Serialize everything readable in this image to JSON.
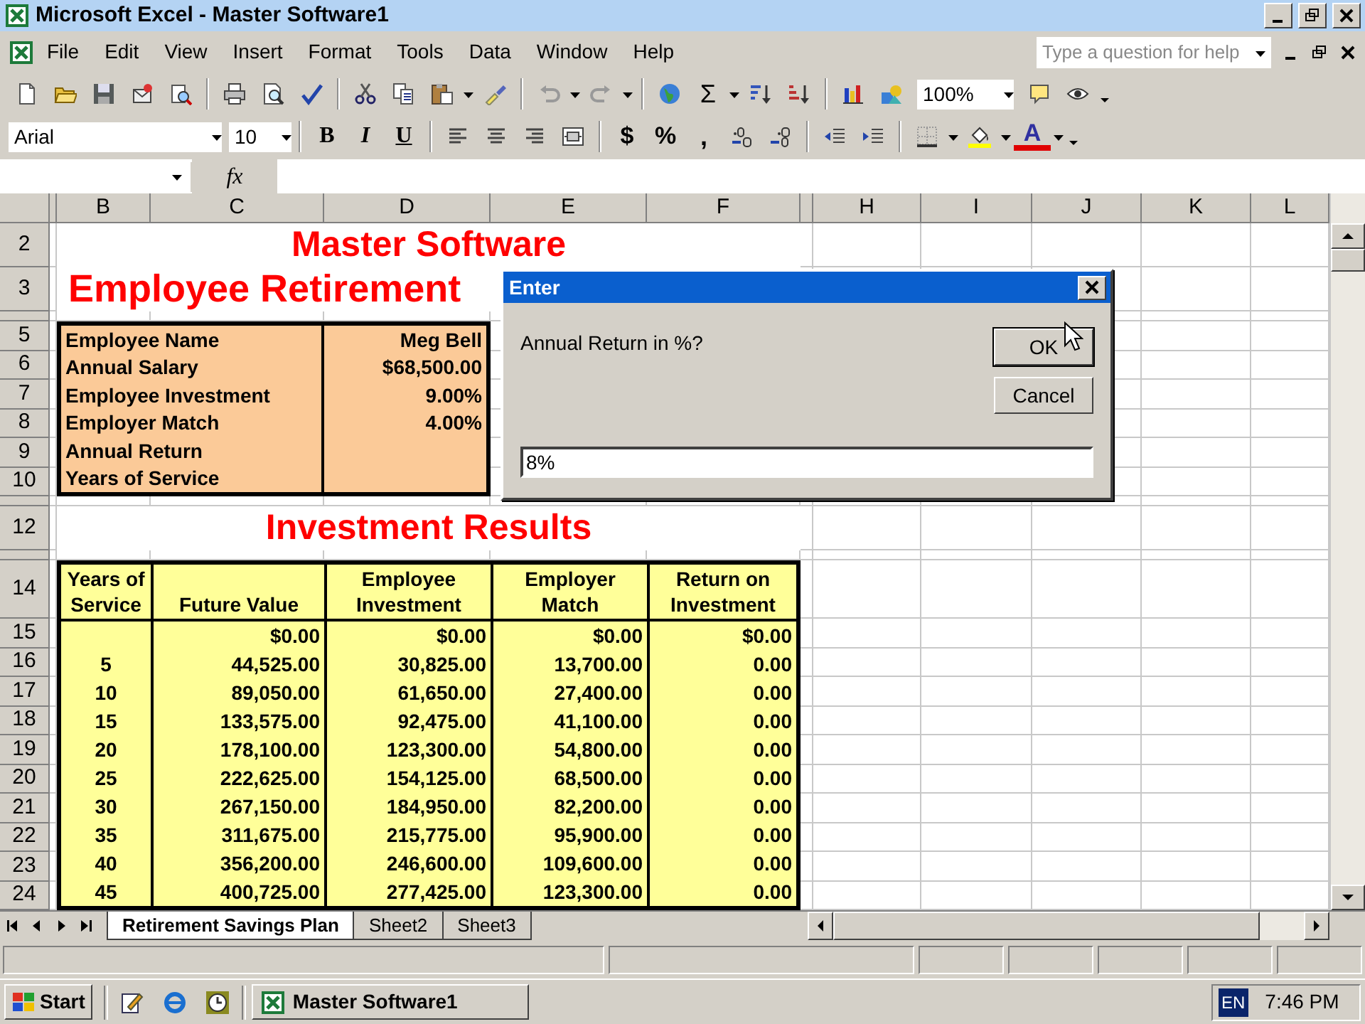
{
  "window": {
    "title": "Microsoft Excel - Master Software1"
  },
  "menu": {
    "items": [
      "File",
      "Edit",
      "View",
      "Insert",
      "Format",
      "Tools",
      "Data",
      "Window",
      "Help"
    ],
    "help_box": {
      "placeholder": "Type a question for help"
    }
  },
  "standard_toolbar": {
    "text_buttons": [
      "Σ"
    ],
    "zoom": "100%"
  },
  "formatting_toolbar": {
    "font": "Arial",
    "size": "10",
    "text_buttons": [
      "B",
      "I",
      "U",
      "$",
      "%",
      ",",
      "A"
    ]
  },
  "formula_bar": {
    "function_label": "fx"
  },
  "column_headers": [
    "B",
    "C",
    "D",
    "E",
    "F",
    "H",
    "I",
    "J",
    "K",
    "L"
  ],
  "row_headers": [
    "2",
    "3",
    "5",
    "6",
    "7",
    "8",
    "9",
    "10",
    "12",
    "14",
    "15",
    "16",
    "17",
    "18",
    "19",
    "20",
    "21",
    "22",
    "23",
    "24"
  ],
  "sheet": {
    "title": "Master Software",
    "subtitle": "Employee Retirement",
    "info_rows": [
      {
        "label": "Employee Name",
        "value": "Meg Bell"
      },
      {
        "label": "Annual Salary",
        "value": "$68,500.00"
      },
      {
        "label": "Employee Investment",
        "value": "9.00%"
      },
      {
        "label": "Employer Match",
        "value": "4.00%"
      },
      {
        "label": "Annual Return"
      },
      {
        "label": "Years of Service"
      }
    ],
    "section_title": "Investment Results",
    "results": {
      "columns": [
        "Years of\nService",
        "Future Value",
        "Employee\nInvestment",
        "Employer\nMatch",
        "Return on\nInvestment"
      ],
      "rows": [
        [
          "",
          "$0.00",
          "$0.00",
          "$0.00",
          "$0.00"
        ],
        [
          "5",
          "44,525.00",
          "30,825.00",
          "13,700.00",
          "0.00"
        ],
        [
          "10",
          "89,050.00",
          "61,650.00",
          "27,400.00",
          "0.00"
        ],
        [
          "15",
          "133,575.00",
          "92,475.00",
          "41,100.00",
          "0.00"
        ],
        [
          "20",
          "178,100.00",
          "123,300.00",
          "54,800.00",
          "0.00"
        ],
        [
          "25",
          "222,625.00",
          "154,125.00",
          "68,500.00",
          "0.00"
        ],
        [
          "30",
          "267,150.00",
          "184,950.00",
          "82,200.00",
          "0.00"
        ],
        [
          "35",
          "311,675.00",
          "215,775.00",
          "95,900.00",
          "0.00"
        ],
        [
          "40",
          "356,200.00",
          "246,600.00",
          "109,600.00",
          "0.00"
        ],
        [
          "45",
          "400,725.00",
          "277,425.00",
          "123,300.00",
          "0.00"
        ]
      ]
    }
  },
  "dialog": {
    "title": "Enter",
    "prompt": "Annual Return in %?",
    "value": "8%",
    "buttons": [
      {
        "label": "OK",
        "default": true
      },
      {
        "label": "Cancel",
        "default": false
      }
    ]
  },
  "sheet_tabs": [
    {
      "label": "Retirement Savings Plan",
      "selected": true
    },
    {
      "label": "Sheet2",
      "selected": false
    },
    {
      "label": "Sheet3",
      "selected": false
    }
  ],
  "taskbar": {
    "start": "Start",
    "tasks": [
      {
        "label": "Master Software1",
        "selected": false
      }
    ],
    "language": "EN",
    "clock": "7:46 PM"
  }
}
